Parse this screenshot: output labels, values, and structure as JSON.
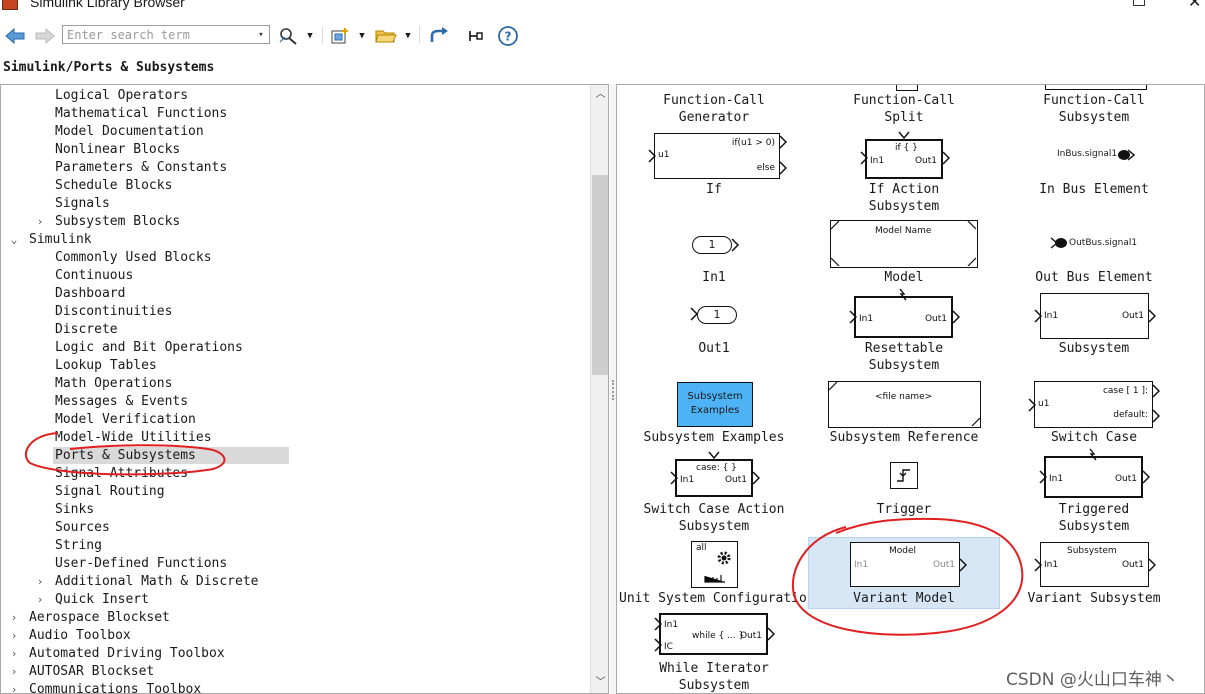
{
  "window": {
    "title": "Simulink Library Browser"
  },
  "toolbar": {
    "search_placeholder": "Enter search term",
    "icons": [
      "back-arrow-icon",
      "forward-arrow-icon",
      "find-icon",
      "dropdown-icon",
      "new-model-icon",
      "dropdown-icon",
      "open-folder-icon",
      "dropdown-icon",
      "refresh-icon",
      "pin-icon",
      "help-icon"
    ]
  },
  "breadcrumb": "Simulink/Ports & Subsystems",
  "tree": {
    "items": [
      {
        "label": "Logical Operators",
        "level": 2,
        "arrow": ""
      },
      {
        "label": "Mathematical Functions",
        "level": 2,
        "arrow": ""
      },
      {
        "label": "Model Documentation",
        "level": 2,
        "arrow": ""
      },
      {
        "label": "Nonlinear Blocks",
        "level": 2,
        "arrow": ""
      },
      {
        "label": "Parameters & Constants",
        "level": 2,
        "arrow": ""
      },
      {
        "label": "Schedule Blocks",
        "level": 2,
        "arrow": ""
      },
      {
        "label": "Signals",
        "level": 2,
        "arrow": ""
      },
      {
        "label": "Subsystem Blocks",
        "level": 2,
        "arrow": "collapsed"
      },
      {
        "label": "Simulink",
        "level": 1,
        "arrow": "expanded"
      },
      {
        "label": "Commonly Used Blocks",
        "level": 2,
        "arrow": ""
      },
      {
        "label": "Continuous",
        "level": 2,
        "arrow": ""
      },
      {
        "label": "Dashboard",
        "level": 2,
        "arrow": ""
      },
      {
        "label": "Discontinuities",
        "level": 2,
        "arrow": ""
      },
      {
        "label": "Discrete",
        "level": 2,
        "arrow": ""
      },
      {
        "label": "Logic and Bit Operations",
        "level": 2,
        "arrow": ""
      },
      {
        "label": "Lookup Tables",
        "level": 2,
        "arrow": ""
      },
      {
        "label": "Math Operations",
        "level": 2,
        "arrow": ""
      },
      {
        "label": "Messages & Events",
        "level": 2,
        "arrow": ""
      },
      {
        "label": "Model Verification",
        "level": 2,
        "arrow": ""
      },
      {
        "label": "Model-Wide Utilities",
        "level": 2,
        "arrow": ""
      },
      {
        "label": "Ports & Subsystems",
        "level": 2,
        "arrow": "",
        "selected": true
      },
      {
        "label": "Signal Attributes",
        "level": 2,
        "arrow": ""
      },
      {
        "label": "Signal Routing",
        "level": 2,
        "arrow": ""
      },
      {
        "label": "Sinks",
        "level": 2,
        "arrow": ""
      },
      {
        "label": "Sources",
        "level": 2,
        "arrow": ""
      },
      {
        "label": "String",
        "level": 2,
        "arrow": ""
      },
      {
        "label": "User-Defined Functions",
        "level": 2,
        "arrow": ""
      },
      {
        "label": "Additional Math & Discrete",
        "level": 2,
        "arrow": "collapsed"
      },
      {
        "label": "Quick Insert",
        "level": 2,
        "arrow": "collapsed"
      },
      {
        "label": "Aerospace Blockset",
        "level": 1,
        "arrow": "collapsed"
      },
      {
        "label": "Audio Toolbox",
        "level": 1,
        "arrow": "collapsed"
      },
      {
        "label": "Automated Driving Toolbox",
        "level": 1,
        "arrow": "collapsed"
      },
      {
        "label": "AUTOSAR Blockset",
        "level": 1,
        "arrow": "collapsed"
      },
      {
        "label": "Communications Toolbox",
        "level": 1,
        "arrow": "collapsed"
      }
    ]
  },
  "blocks": {
    "r0": [
      "Function-Call\nGenerator",
      "Function-Call\nSplit",
      "Function-Call\nSubsystem"
    ],
    "if": {
      "label": "If",
      "in": "u1",
      "out1": "if(u1 > 0)",
      "out2": "else"
    },
    "if_action": {
      "label": "If Action\nSubsystem",
      "top": "if { }",
      "in": "In1",
      "out": "Out1"
    },
    "in_bus": {
      "label": "In Bus Element",
      "text": "InBus.signal1"
    },
    "in1": {
      "label": "In1",
      "num": "1"
    },
    "model": {
      "label": "Model",
      "text": "Model Name"
    },
    "out_bus": {
      "label": "Out Bus Element",
      "text": "OutBus.signal1"
    },
    "out1": {
      "label": "Out1",
      "num": "1"
    },
    "resettable": {
      "label": "Resettable\nSubsystem",
      "in": "In1",
      "out": "Out1"
    },
    "subsystem": {
      "label": "Subsystem",
      "in": "In1",
      "out": "Out1"
    },
    "subsys_examples": {
      "label": "Subsystem Examples",
      "text": "Subsystem\nExamples"
    },
    "subsys_ref": {
      "label": "Subsystem Reference",
      "text": "<file name>"
    },
    "switch_case": {
      "label": "Switch Case",
      "in": "u1",
      "out1": "case [ 1 ]:",
      "out2": "default:"
    },
    "switch_case_action": {
      "label": "Switch Case Action\nSubsystem",
      "top": "case: { }",
      "in": "In1",
      "out": "Out1"
    },
    "trigger": {
      "label": "Trigger"
    },
    "triggered": {
      "label": "Triggered\nSubsystem",
      "in": "In1",
      "out": "Out1"
    },
    "unit_sys": {
      "label": "Unit System Configuration",
      "text": "all"
    },
    "variant_model": {
      "label": "Variant Model",
      "text": "Model",
      "in": "In1",
      "out": "Out1"
    },
    "variant_subsystem": {
      "label": "Variant Subsystem",
      "text": "Subsystem",
      "in": "In1",
      "out": "Out1"
    },
    "while_iter": {
      "label": "While Iterator\nSubsystem",
      "in1": "In1",
      "in2": "IC",
      "mid": "while { ... }",
      "out": "Out1"
    }
  },
  "watermark": "CSDN @火山口车神丶",
  "colors": {
    "accent_blue": "#4db3f5",
    "selection": "#d6e6f5",
    "annotation_red": "#e02020"
  }
}
